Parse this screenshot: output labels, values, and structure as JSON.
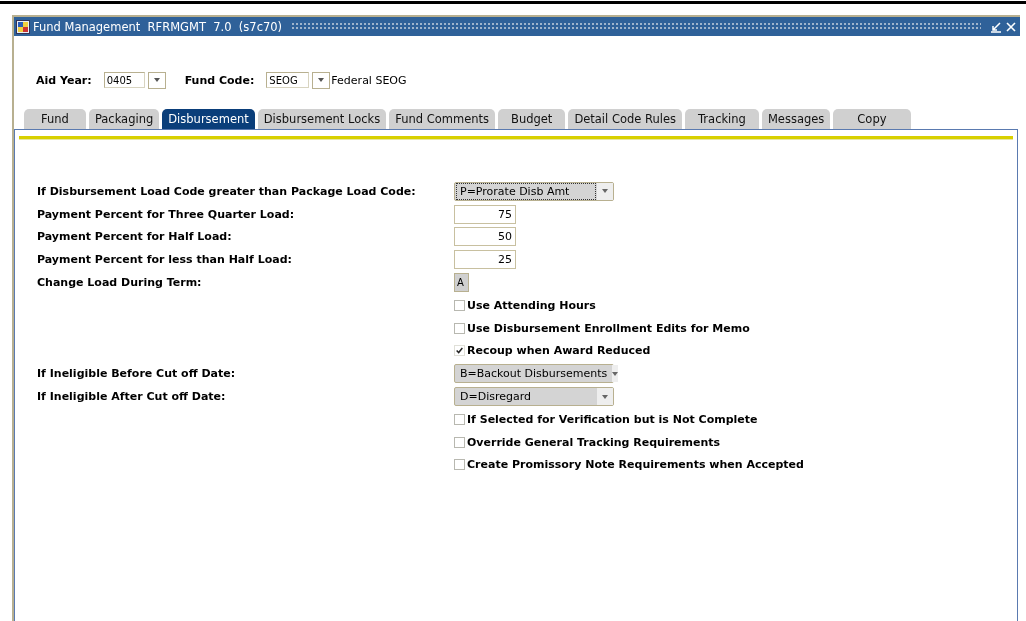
{
  "window": {
    "title": "Fund Management  RFRMGMT  7.0  (s7c70)"
  },
  "key_block": {
    "aid_year": {
      "label": "Aid Year:",
      "value": "0405"
    },
    "fund_code": {
      "label": "Fund Code:",
      "value": "SEOG",
      "description": "Federal SEOG"
    }
  },
  "tabs": [
    {
      "label": "Fund",
      "selected": false
    },
    {
      "label": "Packaging",
      "selected": false
    },
    {
      "label": "Disbursement",
      "selected": true
    },
    {
      "label": "Disbursement Locks",
      "selected": false
    },
    {
      "label": "Fund Comments",
      "selected": false
    },
    {
      "label": "Budget",
      "selected": false
    },
    {
      "label": "Detail Code Rules",
      "selected": false
    },
    {
      "label": "Tracking",
      "selected": false
    },
    {
      "label": "Messages",
      "selected": false
    },
    {
      "label": "Copy",
      "selected": false
    }
  ],
  "form": [
    {
      "kind": "select",
      "label": "If Disbursement Load Code greater than Package Load Code:",
      "value": "P=Prorate Disb Amt",
      "focused": true
    },
    {
      "kind": "number",
      "label": "Payment Percent for Three Quarter Load:",
      "value": "75"
    },
    {
      "kind": "number",
      "label": "Payment Percent for Half Load:",
      "value": "50"
    },
    {
      "kind": "number",
      "label": "Payment Percent for less than Half Load:",
      "value": "25"
    },
    {
      "kind": "code",
      "label": "Change Load During Term:",
      "value": "A"
    },
    {
      "kind": "checkbox",
      "label": "Use Attending Hours",
      "checked": false
    },
    {
      "kind": "checkbox",
      "label": "Use Disbursement Enrollment Edits for Memo",
      "checked": false
    },
    {
      "kind": "checkbox",
      "label": "Recoup when Award Reduced",
      "checked": true
    },
    {
      "kind": "select",
      "label": "If Ineligible Before Cut off Date:",
      "value": "B=Backout Disbursements",
      "focused": false
    },
    {
      "kind": "select",
      "label": "If Ineligible After Cut off Date:",
      "value": "D=Disregard",
      "focused": false
    },
    {
      "kind": "checkbox",
      "label": "If Selected for Verification but is Not Complete",
      "checked": false
    },
    {
      "kind": "checkbox",
      "label": "Override General Tracking Requirements",
      "checked": false
    },
    {
      "kind": "checkbox",
      "label": "Create Promissory Note Requirements when Accepted",
      "checked": false
    }
  ]
}
